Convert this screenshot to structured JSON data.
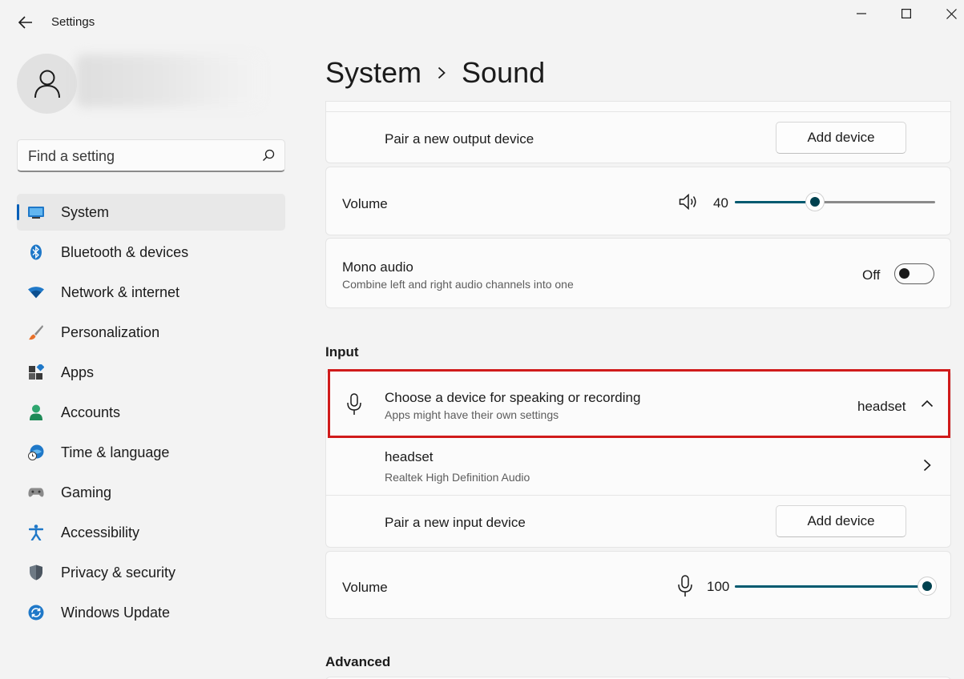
{
  "window": {
    "title": "Settings",
    "back_icon": "back-arrow-icon",
    "controls": [
      "minimize-icon",
      "maximize-icon",
      "close-icon"
    ]
  },
  "sidebar": {
    "avatar_icon": "user-icon",
    "search": {
      "placeholder": "Find a setting",
      "value": "",
      "icon": "search-icon"
    },
    "nav": [
      {
        "label": "System",
        "icon": "system-display-icon",
        "active": true
      },
      {
        "label": "Bluetooth & devices",
        "icon": "bluetooth-icon"
      },
      {
        "label": "Network & internet",
        "icon": "wifi-icon"
      },
      {
        "label": "Personalization",
        "icon": "paintbrush-icon"
      },
      {
        "label": "Apps",
        "icon": "apps-icon"
      },
      {
        "label": "Accounts",
        "icon": "accounts-icon"
      },
      {
        "label": "Time & language",
        "icon": "time-language-icon"
      },
      {
        "label": "Gaming",
        "icon": "gamepad-icon"
      },
      {
        "label": "Accessibility",
        "icon": "accessibility-icon"
      },
      {
        "label": "Privacy & security",
        "icon": "shield-icon"
      },
      {
        "label": "Windows Update",
        "icon": "windows-update-icon"
      }
    ]
  },
  "breadcrumb": {
    "parent": "System",
    "current": "Sound"
  },
  "output": {
    "pair_label": "Pair a new output device",
    "add_button": "Add device",
    "volume_label": "Volume",
    "volume_value": "40",
    "volume_fraction": 0.4,
    "volume_icon": "speaker-icon",
    "mono_title": "Mono audio",
    "mono_desc": "Combine left and right audio channels into one",
    "mono_state": "Off"
  },
  "input": {
    "heading": "Input",
    "choose_title": "Choose a device for speaking or recording",
    "choose_desc": "Apps might have their own settings",
    "selected_device": "headset",
    "device_name": "headset",
    "device_desc": "Realtek High Definition Audio",
    "pair_label": "Pair a new input device",
    "add_button": "Add device",
    "volume_label": "Volume",
    "volume_value": "100",
    "volume_fraction": 1.0,
    "volume_icon": "microphone-icon"
  },
  "advanced": {
    "heading": "Advanced"
  },
  "colors": {
    "accent": "#005fb8",
    "slider_fill": "#005a70",
    "highlight": "#d01b1b"
  }
}
